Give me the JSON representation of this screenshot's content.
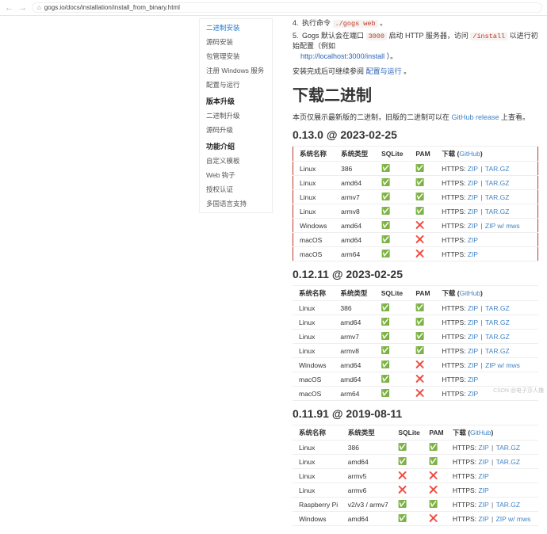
{
  "browser": {
    "back": "←",
    "fwd": "→",
    "url": "gogs.io/docs/installation/install_from_binary.html"
  },
  "sidebar": {
    "groups": [
      {
        "title": "",
        "items": [
          "二进制安装",
          "源码安装",
          "包管理安装",
          "注册 Windows 服务",
          "配置与运行"
        ],
        "active": 0
      },
      {
        "title": "版本升级",
        "items": [
          "二进制升级",
          "源码升级"
        ]
      },
      {
        "title": "功能介绍",
        "items": [
          "自定义模板",
          "Web 钩子",
          "授权认证",
          "多国语言支持"
        ]
      }
    ]
  },
  "steps": {
    "s4": {
      "num": "4.",
      "text": "执行命令",
      "code": "./gogs web",
      "tail": "。"
    },
    "s5": {
      "num": "5.",
      "pre": "Gogs 默认会在端口",
      "port": "3000",
      "mid": "启动 HTTP 服务器，访问",
      "path": "/install",
      "mid2": "以进行初始配置（例如",
      "url": "http://localhost:3000/install",
      "close": "）。"
    },
    "after": {
      "text": "安装完成后可继续参阅",
      "link": "配置与运行",
      "tail": "。"
    }
  },
  "h1": "下载二进制",
  "intro": {
    "pre": "本页仅展示最新版的二进制，旧版的二进制可以在 ",
    "link": "GitHub release",
    "post": " 上查看。"
  },
  "cols": {
    "os": "系统名称",
    "arch": "系统类型",
    "sqlite": "SQLite",
    "pam": "PAM",
    "dl": "下载",
    "github": "GitHub"
  },
  "dl": {
    "zip": "ZIP",
    "targz": "TAR.GZ",
    "zipmws": "ZIP w/ mws",
    "prefix": "HTTPS: "
  },
  "releases": [
    {
      "heading": "0.13.0 @ 2023-02-25",
      "featured": true,
      "rows": [
        {
          "os": "Linux",
          "arch": "386",
          "sqlite": true,
          "pam": true,
          "links": [
            "zip",
            "targz"
          ]
        },
        {
          "os": "Linux",
          "arch": "amd64",
          "sqlite": true,
          "pam": true,
          "links": [
            "zip",
            "targz"
          ]
        },
        {
          "os": "Linux",
          "arch": "armv7",
          "sqlite": true,
          "pam": true,
          "links": [
            "zip",
            "targz"
          ]
        },
        {
          "os": "Linux",
          "arch": "armv8",
          "sqlite": true,
          "pam": true,
          "links": [
            "zip",
            "targz"
          ]
        },
        {
          "os": "Windows",
          "arch": "amd64",
          "sqlite": true,
          "pam": false,
          "links": [
            "zip",
            "zipmws"
          ]
        },
        {
          "os": "macOS",
          "arch": "amd64",
          "sqlite": true,
          "pam": false,
          "links": [
            "zip"
          ]
        },
        {
          "os": "macOS",
          "arch": "arm64",
          "sqlite": true,
          "pam": false,
          "links": [
            "zip"
          ]
        }
      ]
    },
    {
      "heading": "0.12.11 @ 2023-02-25",
      "featured": false,
      "rows": [
        {
          "os": "Linux",
          "arch": "386",
          "sqlite": true,
          "pam": true,
          "links": [
            "zip",
            "targz"
          ]
        },
        {
          "os": "Linux",
          "arch": "amd64",
          "sqlite": true,
          "pam": true,
          "links": [
            "zip",
            "targz"
          ]
        },
        {
          "os": "Linux",
          "arch": "armv7",
          "sqlite": true,
          "pam": true,
          "links": [
            "zip",
            "targz"
          ]
        },
        {
          "os": "Linux",
          "arch": "armv8",
          "sqlite": true,
          "pam": true,
          "links": [
            "zip",
            "targz"
          ]
        },
        {
          "os": "Windows",
          "arch": "amd64",
          "sqlite": true,
          "pam": false,
          "links": [
            "zip",
            "zipmws"
          ]
        },
        {
          "os": "macOS",
          "arch": "amd64",
          "sqlite": true,
          "pam": false,
          "links": [
            "zip"
          ]
        },
        {
          "os": "macOS",
          "arch": "arm64",
          "sqlite": true,
          "pam": false,
          "links": [
            "zip"
          ]
        }
      ]
    },
    {
      "heading": "0.11.91 @ 2019-08-11",
      "featured": false,
      "rows": [
        {
          "os": "Linux",
          "arch": "386",
          "sqlite": true,
          "pam": true,
          "links": [
            "zip",
            "targz"
          ]
        },
        {
          "os": "Linux",
          "arch": "amd64",
          "sqlite": true,
          "pam": true,
          "links": [
            "zip",
            "targz"
          ]
        },
        {
          "os": "Linux",
          "arch": "armv5",
          "sqlite": false,
          "pam": false,
          "links": [
            "zip"
          ]
        },
        {
          "os": "Linux",
          "arch": "armv6",
          "sqlite": false,
          "pam": false,
          "links": [
            "zip"
          ]
        },
        {
          "os": "Raspberry Pi",
          "arch": "v2/v3 / armv7",
          "sqlite": true,
          "pam": true,
          "links": [
            "zip",
            "targz"
          ]
        },
        {
          "os": "Windows",
          "arch": "amd64",
          "sqlite": true,
          "pam": false,
          "links": [
            "zip",
            "zipmws"
          ]
        }
      ]
    }
  ],
  "footer": "CSDN @电子莎人撸"
}
